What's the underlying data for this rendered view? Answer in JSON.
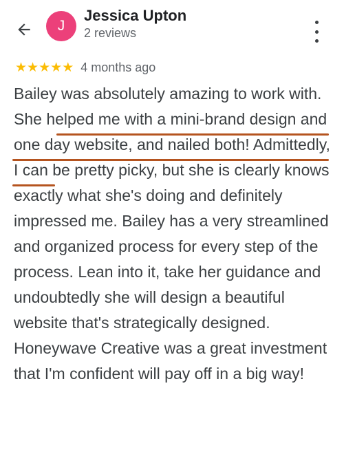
{
  "reviewer": {
    "avatar_initial": "J",
    "name": "Jessica Upton",
    "review_count": "2 reviews"
  },
  "review": {
    "rating": 5,
    "stars": [
      "★",
      "★",
      "★",
      "★",
      "★"
    ],
    "time_ago": "4 months ago",
    "text": "Bailey was absolutely amazing to work with. She helped me with a mini-brand design and one day website, and nailed both! Admittedly, I can be pretty picky, but she is clearly knows exactly what she's doing and definitely impressed me. Bailey has a very streamlined and organized process for every step of the process. Lean into it, take her guidance and undoubtedly she will design a beautiful website that's strategically designed. Honeywave Creative was a great investment that I'm confident will pay off in a big way!"
  },
  "icons": {
    "back": "arrow-left-icon",
    "more": "more-vertical-icon"
  },
  "colors": {
    "avatar_bg": "#ec407a",
    "star": "#fbbc04",
    "highlight_underline": "#b5541f",
    "text": "#3c4043",
    "subtle_text": "#5f6368"
  }
}
